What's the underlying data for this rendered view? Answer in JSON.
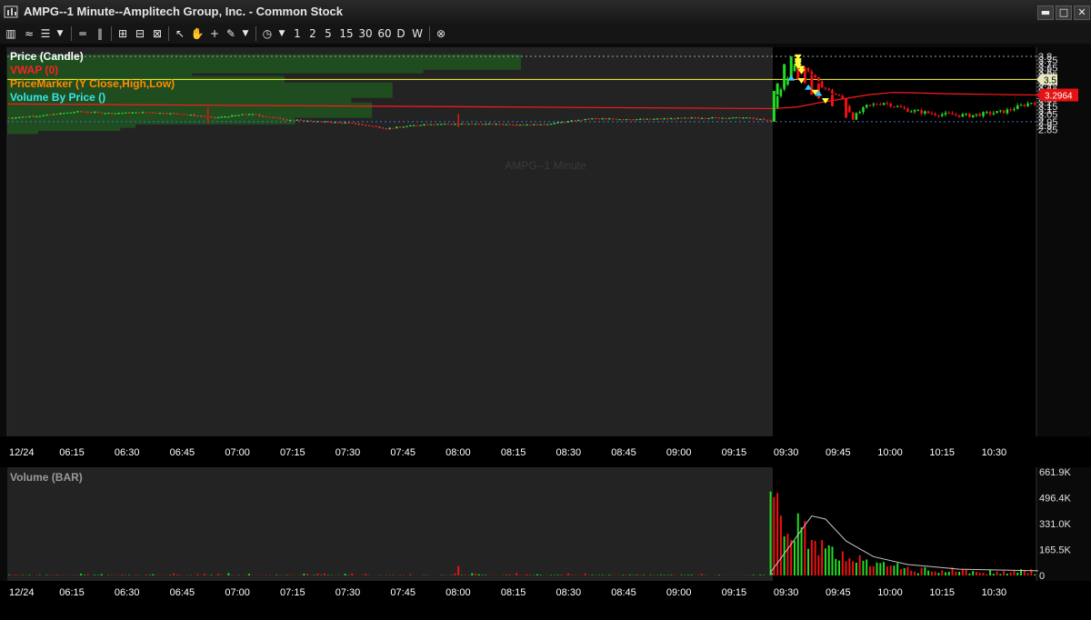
{
  "window": {
    "title": "AMPG--1 Minute--Amplitech Group, Inc. - Common Stock",
    "minimize_glyph": "▬",
    "maximize_glyph": "□",
    "close_glyph": "✕"
  },
  "toolbar": {
    "timeframes": [
      "1",
      "2",
      "5",
      "15",
      "30",
      "60",
      "D",
      "W"
    ]
  },
  "price_panel": {
    "legend": [
      {
        "label": "Price (Candle)",
        "color": "#ffffff"
      },
      {
        "label": "VWAP (0)",
        "color": "#ff2020"
      },
      {
        "label": "PriceMarker (Y Close,High,Low)",
        "color": "#ff8c00"
      },
      {
        "label": "Volume By Price ()",
        "color": "#39e6e6"
      }
    ],
    "watermark": "AMPG--1 Minute",
    "y_ticks": [
      "3.8",
      "3.75",
      "3.7",
      "3.65",
      "3.6",
      "3.55",
      "3.5",
      "3.45",
      "3.4",
      "3.35",
      "3.3",
      "3.25",
      "3.2",
      "3.15",
      "3.1",
      "3.05",
      "3",
      "2.95",
      "2.9",
      "2.85"
    ],
    "price_marker_label": "3.5",
    "vwap_label": "3.2964",
    "colors": {
      "up": "#22dd22",
      "down": "#ee1111",
      "vwap": "#ff1a1a",
      "marker_line": "#ffff33",
      "vbp": "#1f4d1f",
      "extended_hours_bg": "#232323",
      "regular_bg": "#000000"
    }
  },
  "time_axis": {
    "date_label": "12/24",
    "labels": [
      "06:15",
      "06:30",
      "06:45",
      "07:00",
      "07:15",
      "07:30",
      "07:45",
      "08:00",
      "08:15",
      "08:30",
      "08:45",
      "09:00",
      "09:15",
      "09:30",
      "09:45",
      "10:00",
      "10:15",
      "10:30"
    ]
  },
  "volume_panel": {
    "title": "Volume (BAR)",
    "y_ticks": [
      "661.9K",
      "496.4K",
      "331.0K",
      "165.5K",
      "0"
    ]
  },
  "chart_data": {
    "type": "candlestick",
    "symbol": "AMPG",
    "interval": "1 Minute",
    "ylim": [
      2.82,
      3.82
    ],
    "volume_ylim": [
      0,
      661900
    ],
    "volume_by_price": [
      {
        "price": 3.725,
        "volume": 100
      },
      {
        "price": 3.68,
        "volume": 81
      },
      {
        "price": 3.64,
        "volume": 18
      },
      {
        "price": 3.595,
        "volume": 36
      },
      {
        "price": 3.445,
        "volume": 54
      },
      {
        "price": 3.4,
        "volume": 40
      },
      {
        "price": 3.36,
        "volume": 75
      },
      {
        "price": 3.315,
        "volume": 11
      },
      {
        "price": 3.225,
        "volume": 67
      },
      {
        "price": 3.18,
        "volume": 20
      },
      {
        "price": 3.14,
        "volume": 55
      },
      {
        "price": 3.1,
        "volume": 71
      },
      {
        "price": 3.06,
        "volume": 19
      },
      {
        "price": 3.015,
        "volume": 56
      },
      {
        "price": 2.97,
        "volume": 25
      },
      {
        "price": 2.93,
        "volume": 22
      },
      {
        "price": 2.89,
        "volume": 6
      }
    ],
    "vwap_premarket": {
      "start": 3.18,
      "end": 3.12
    },
    "vwap_regular": [
      3.12,
      3.14,
      3.2,
      3.25,
      3.3,
      3.33,
      3.325,
      3.315,
      3.31,
      3.305,
      3.3,
      3.298
    ]
  }
}
